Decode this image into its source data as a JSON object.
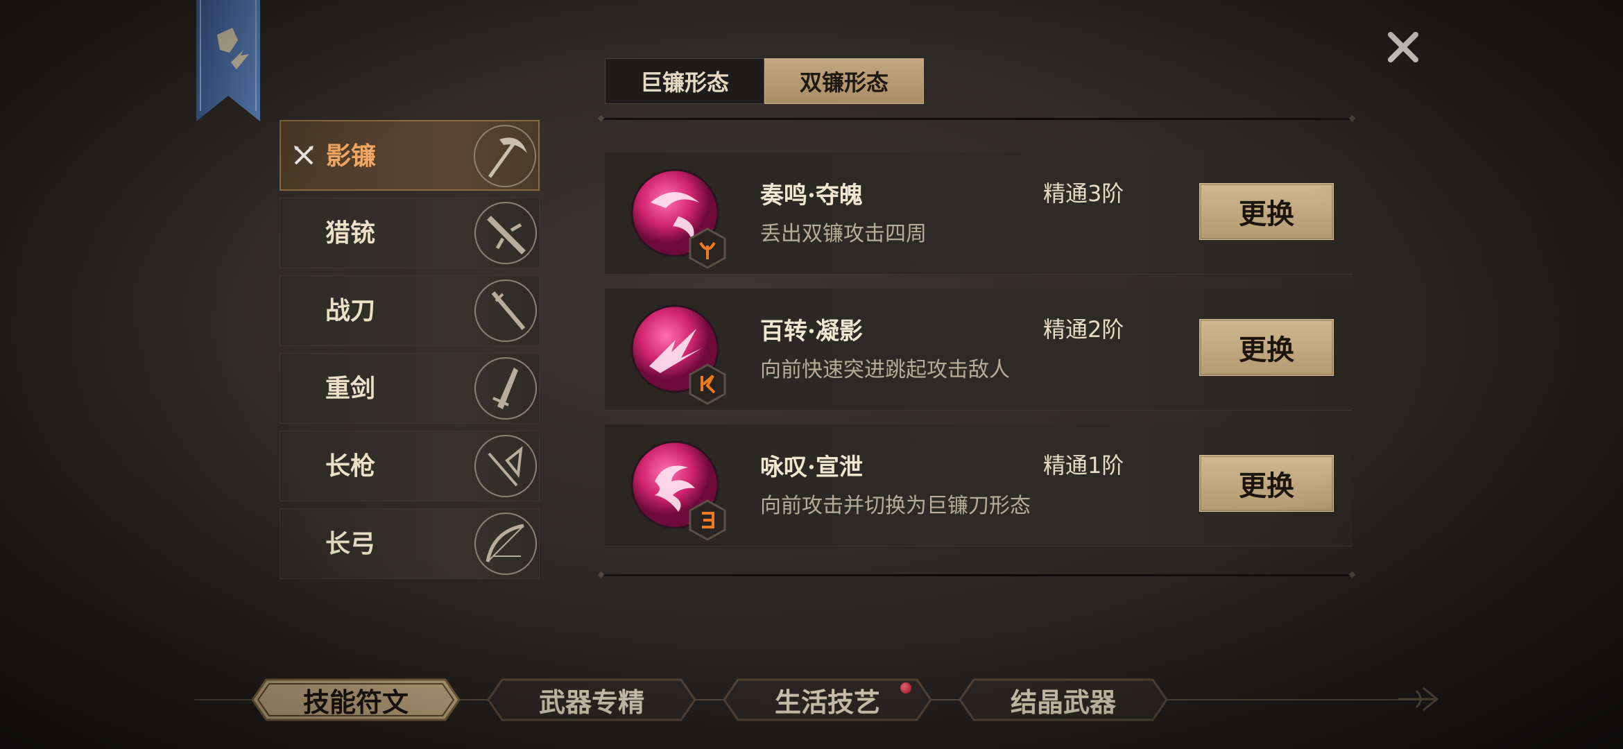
{
  "forms": {
    "tabs": [
      {
        "label": "巨镰形态",
        "active": false
      },
      {
        "label": "双镰形态",
        "active": true
      }
    ]
  },
  "weapons": [
    {
      "label": "影镰",
      "icon": "scythe-icon",
      "selected": true
    },
    {
      "label": "猎铳",
      "icon": "gun-icon",
      "selected": false
    },
    {
      "label": "战刀",
      "icon": "blade-icon",
      "selected": false
    },
    {
      "label": "重剑",
      "icon": "greatsword-icon",
      "selected": false
    },
    {
      "label": "长枪",
      "icon": "spear-icon",
      "selected": false
    },
    {
      "label": "长弓",
      "icon": "bow-icon",
      "selected": false
    }
  ],
  "skills": [
    {
      "name": "奏鸣·夺魄",
      "level": "精通3阶",
      "desc": "丢出双镰攻击四周",
      "button": "更换",
      "icon": "scythe-swirl-icon",
      "badge": "trident-rune-badge"
    },
    {
      "name": "百转·凝影",
      "level": "精通2阶",
      "desc": "向前快速突进跳起攻击敌人",
      "button": "更换",
      "icon": "burst-slash-icon",
      "badge": "lightning-rune-badge"
    },
    {
      "name": "咏叹·宣泄",
      "level": "精通1阶",
      "desc": "向前攻击并切换为巨镰刀形态",
      "button": "更换",
      "icon": "phoenix-spiral-icon",
      "badge": "hook-rune-badge"
    }
  ],
  "bottom_nav": [
    {
      "label": "技能符文",
      "active": true,
      "badge": false
    },
    {
      "label": "武器专精",
      "active": false,
      "badge": false
    },
    {
      "label": "生活技艺",
      "active": false,
      "badge": true
    },
    {
      "label": "结晶武器",
      "active": false,
      "badge": false
    }
  ],
  "colors": {
    "accent_gold": "#b39a72",
    "selected_text": "#f2a766",
    "skill_orb": "#d0256e",
    "notification": "#b3102a"
  }
}
